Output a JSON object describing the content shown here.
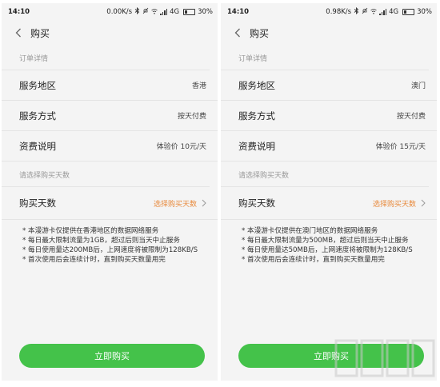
{
  "phones": [
    {
      "status": {
        "time": "14:10",
        "speed": "0.00K/s",
        "network": "4G",
        "battery": "30%"
      },
      "title": "购买",
      "order_header": "订单详情",
      "rows": [
        {
          "label": "服务地区",
          "value": "香港"
        },
        {
          "label": "服务方式",
          "value": "按天付费"
        },
        {
          "label": "资费说明",
          "value": "体验价 10元/天"
        }
      ],
      "days_header": "请选择购买天数",
      "days_row": {
        "label": "购买天数",
        "value": "选择购买天数"
      },
      "notes": [
        "* 本漫游卡仅提供在香港地区的数据网络服务",
        "* 每日最大限制流量为1GB，超过后则当天中止服务",
        "* 每日使用量达200MB后，上网速度将被限制为128KB/S",
        "* 首次使用后会连续计时，直到购买天数量用完"
      ],
      "buy_button": "立即购买"
    },
    {
      "status": {
        "time": "14:10",
        "speed": "0.98K/s",
        "network": "4G",
        "battery": "30%"
      },
      "title": "购买",
      "order_header": "订单详情",
      "rows": [
        {
          "label": "服务地区",
          "value": "澳门"
        },
        {
          "label": "服务方式",
          "value": "按天付费"
        },
        {
          "label": "资费说明",
          "value": "体验价 15元/天"
        }
      ],
      "days_header": "请选择购买天数",
      "days_row": {
        "label": "购买天数",
        "value": "选择购买天数"
      },
      "notes": [
        "* 本漫游卡仅提供在澳门地区的数据网络服务",
        "* 每日最大限制流量为500MB，超过后则当天中止服务",
        "* 每日使用量达50MB后，上网速度将被限制为128KB/S",
        "* 首次使用后会连续计时，直到购买天数量用完"
      ],
      "buy_button": "立即购买"
    }
  ],
  "colors": {
    "accent_green": "#44c24a",
    "accent_orange": "#e8893b",
    "background": "#f4f4f4"
  }
}
